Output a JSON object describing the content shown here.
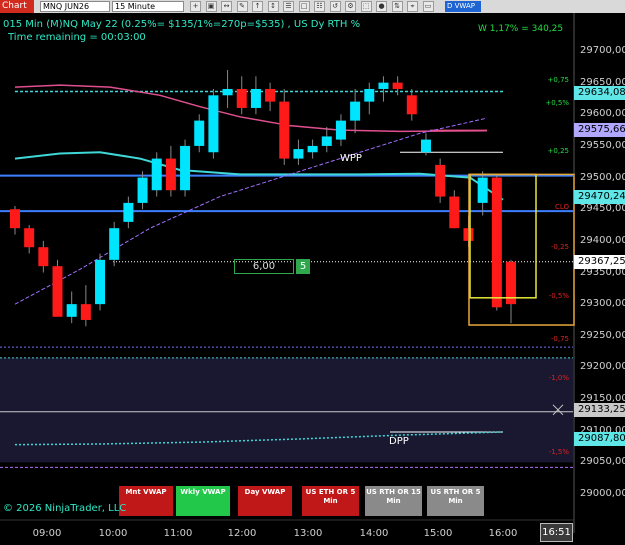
{
  "toolbar": {
    "chart_tab": "Chart",
    "instrument": "MNQ JUN26",
    "interval": "15 Minute",
    "vwap_button": "D VWAP",
    "buttons": [
      "+",
      "▣",
      "↔",
      "✎",
      "↑",
      "↕",
      "☰",
      "□",
      "☷",
      "↺",
      "⚙",
      "⬚",
      "●",
      "⇅",
      "⌖",
      "▭"
    ]
  },
  "header": {
    "line1": "015 Min (M)NQ May 22 (0.25%= $135/1%=270p=$535) , US Dy RTH %",
    "line2": "Time remaining = 00:03:00",
    "weekly": "W 1,17% = 340,25"
  },
  "chart_data": {
    "type": "candlestick",
    "x_ticks": [
      "09:00",
      "10:00",
      "11:00",
      "12:00",
      "13:00",
      "14:00",
      "15:00",
      "16:00"
    ],
    "y_ticks": [
      "29700,00",
      "29650,00",
      "29600,00",
      "29550,00",
      "29500,00",
      "29450,00",
      "29400,00",
      "29350,00",
      "29300,00",
      "29250,00",
      "29200,00",
      "29150,00",
      "29100,00",
      "29050,00",
      "29000,00"
    ],
    "percent_labels": [
      {
        "label": "+0,75",
        "color": "#22dd44"
      },
      {
        "label": "+0,5%",
        "color": "#22dd44"
      },
      {
        "label": "+0,25",
        "color": "#22dd44"
      },
      {
        "label": "CLO",
        "color": "#dd2222"
      },
      {
        "label": "-0,25",
        "color": "#dd2222"
      },
      {
        "label": "-0,5%",
        "color": "#dd2222"
      },
      {
        "label": "-0,75",
        "color": "#dd2222"
      },
      {
        "label": "-1,0%",
        "color": "#dd2222"
      },
      {
        "label": "-1,5%",
        "color": "#dd2222"
      }
    ],
    "price_tags": [
      {
        "label": "29634,08",
        "bg": "#5fe7e7"
      },
      {
        "label": "29575,66",
        "bg": "#b0a7ff"
      },
      {
        "label": "29470,24",
        "bg": "#5fe7e7"
      },
      {
        "label": "29367,25",
        "bg": "#ffffff"
      },
      {
        "label": "29133,25",
        "bg": "#c8c8c8"
      },
      {
        "label": "29087,80",
        "bg": "#5fe7e7"
      }
    ],
    "annotations": {
      "wpp": "WPP",
      "dpp": "DPP",
      "box_value": "6,00",
      "box_count": "5"
    },
    "candles": [
      {
        "o": 29450,
        "h": 29455,
        "l": 29410,
        "c": 29420
      },
      {
        "o": 29420,
        "h": 29425,
        "l": 29380,
        "c": 29390
      },
      {
        "o": 29390,
        "h": 29400,
        "l": 29350,
        "c": 29360
      },
      {
        "o": 29360,
        "h": 29370,
        "l": 29310,
        "c": 29280
      },
      {
        "o": 29280,
        "h": 29320,
        "l": 29270,
        "c": 29300
      },
      {
        "o": 29300,
        "h": 29330,
        "l": 29265,
        "c": 29275
      },
      {
        "o": 29300,
        "h": 29380,
        "l": 29290,
        "c": 29370
      },
      {
        "o": 29370,
        "h": 29430,
        "l": 29360,
        "c": 29420
      },
      {
        "o": 29430,
        "h": 29470,
        "l": 29420,
        "c": 29460
      },
      {
        "o": 29460,
        "h": 29510,
        "l": 29450,
        "c": 29500
      },
      {
        "o": 29480,
        "h": 29540,
        "l": 29470,
        "c": 29530
      },
      {
        "o": 29530,
        "h": 29550,
        "l": 29470,
        "c": 29480
      },
      {
        "o": 29480,
        "h": 29560,
        "l": 29470,
        "c": 29550
      },
      {
        "o": 29550,
        "h": 29600,
        "l": 29540,
        "c": 29590
      },
      {
        "o": 29540,
        "h": 29640,
        "l": 29530,
        "c": 29630
      },
      {
        "o": 29630,
        "h": 29670,
        "l": 29610,
        "c": 29640
      },
      {
        "o": 29640,
        "h": 29660,
        "l": 29600,
        "c": 29610
      },
      {
        "o": 29610,
        "h": 29660,
        "l": 29600,
        "c": 29640
      },
      {
        "o": 29640,
        "h": 29650,
        "l": 29605,
        "c": 29620
      },
      {
        "o": 29620,
        "h": 29640,
        "l": 29520,
        "c": 29530
      },
      {
        "o": 29530,
        "h": 29560,
        "l": 29520,
        "c": 29545
      },
      {
        "o": 29540,
        "h": 29560,
        "l": 29530,
        "c": 29550
      },
      {
        "o": 29550,
        "h": 29580,
        "l": 29540,
        "c": 29565
      },
      {
        "o": 29560,
        "h": 29600,
        "l": 29550,
        "c": 29590
      },
      {
        "o": 29590,
        "h": 29640,
        "l": 29570,
        "c": 29620
      },
      {
        "o": 29620,
        "h": 29650,
        "l": 29600,
        "c": 29640
      },
      {
        "o": 29640,
        "h": 29660,
        "l": 29620,
        "c": 29650
      },
      {
        "o": 29650,
        "h": 29660,
        "l": 29630,
        "c": 29640
      },
      {
        "o": 29630,
        "h": 29640,
        "l": 29590,
        "c": 29600
      },
      {
        "o": 29540,
        "h": 29570,
        "l": 29535,
        "c": 29560
      },
      {
        "o": 29520,
        "h": 29530,
        "l": 29460,
        "c": 29470
      },
      {
        "o": 29470,
        "h": 29480,
        "l": 29420,
        "c": 29420
      },
      {
        "o": 29420,
        "h": 29440,
        "l": 29390,
        "c": 29400
      },
      {
        "o": 29460,
        "h": 29510,
        "l": 29440,
        "c": 29500
      },
      {
        "o": 29500,
        "h": 29505,
        "l": 29290,
        "c": 29295
      },
      {
        "o": 29367,
        "h": 29370,
        "l": 29270,
        "c": 29300
      }
    ]
  },
  "indicator_buttons": [
    {
      "label": "Mnt VWAP",
      "bg": "#c01818",
      "fg": "#ffffff"
    },
    {
      "label": "Wkly VWAP",
      "bg": "#22c84a",
      "fg": "#ffffff"
    },
    {
      "label": "Day VWAP",
      "bg": "#c01818",
      "fg": "#ffffff"
    },
    {
      "label": "US ETH OR 5 Min",
      "bg": "#c01818",
      "fg": "#ffffff"
    },
    {
      "label": "US RTH OR 15 Min",
      "bg": "#8a8a8a",
      "fg": "#ffffff"
    },
    {
      "label": "US RTH OR 5 Min",
      "bg": "#8a8a8a",
      "fg": "#ffffff"
    }
  ],
  "footer": {
    "copyright": "© 2026 NinjaTrader, LLC",
    "current_time": "16:51"
  }
}
